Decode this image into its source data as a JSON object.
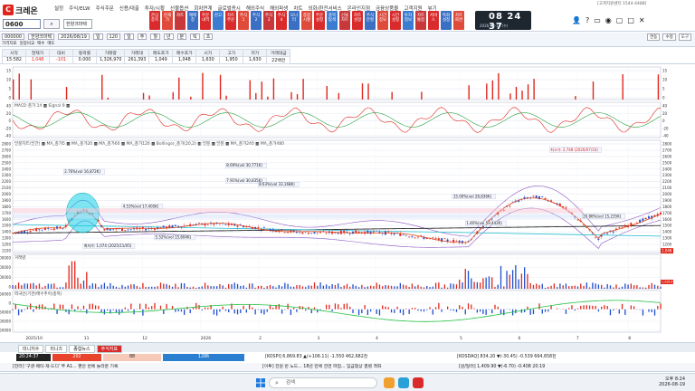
{
  "app": {
    "title": "크레온",
    "logo_letter": "C"
  },
  "menu": [
    "설정",
    "주식/ELW",
    "주식주문",
    "신용/대출",
    "투자/시황",
    "선물옵션",
    "회차연계",
    "글로벌증시",
    "해외주식",
    "해외파생",
    "차트",
    "외화/환전서비스",
    "온라인지점",
    "금융상품몰",
    "고객지원",
    "뷰기"
  ],
  "code": "0600",
  "stock_name": "한양크마텍",
  "toolbar": [
    "관심\n종목",
    "현재\n가",
    "차트",
    "매매\n창",
    "주문\n내역",
    "잔고",
    "차트\n주문",
    "주식\n1",
    "주식\n2",
    "주식\n3",
    "주식\n4",
    "모니\n터",
    "종합\n시황",
    "주문\n설정",
    "종목\n탐색",
    "선물\n차트",
    "차트\n설정",
    "주식\n분할",
    "시간\n정보",
    "시간\n설정",
    "투자\n정보",
    "차트\n통합",
    "서비\n스",
    "특화\n설정",
    "차트\n화면"
  ],
  "clock": {
    "time": "08 24 37",
    "date": "2026-08-19 (수)"
  },
  "top_right": "[고객지원센터 1544-4488]",
  "controls": {
    "code": "000000",
    "name": "한양크마텍",
    "date": "2026/08/19",
    "period": "일",
    "count": "120",
    "labels": [
      "일",
      "주",
      "월",
      "년",
      "분",
      "틱",
      "초"
    ],
    "right_buttons": [
      "연동",
      "수정",
      "도구"
    ],
    "sub_tabs": [
      "가격지표",
      "일봉비교",
      "매수",
      "매도"
    ]
  },
  "quote": {
    "headers": [
      "시작",
      "현재가",
      "대비",
      "등락률",
      "거래량",
      "거래대",
      "매도호가",
      "매수호가",
      "시가",
      "고가",
      "저가",
      "거래대금"
    ],
    "values": [
      "15:582",
      "1,048",
      "-101",
      "0.000",
      "1,326,970",
      "261,393",
      "1,049",
      "1,048",
      "1,630",
      "1,950",
      "1,630",
      "22백만"
    ]
  },
  "chart": {
    "macd_label": "MACD 종가 14 ■ Signal 9 ■",
    "price_label": "일봉차트(일간) ■ MA_종가5 ■ MA_종가20 ■ MA_종가60 ■ MA_종가120 ■ Bollinger_종가(20,2) ■ 일봉 ■ 일봉 ■ MA_종가240 ■ MA_종가480",
    "volume_label": "거래량",
    "investor_label": "외국인(기관)매수추이(종목)",
    "price_annotations": [
      "최고가: 2,748 (2026/07/10)",
      "최저가: 1,074 (2025/11/05)",
      "8.69%(vol 30,771K)",
      "7.91%(vol 30,835K)",
      "8.63%(vol 33,168K)",
      "2.76%(vol 16,872K)",
      "4.53%(vol 17,405K)",
      "5.52%(vol 15,604K)",
      "15.00%(vol 28,836K)",
      "1.46%(vol 59,442K)",
      "20.86%(vol 15,235K)"
    ],
    "x_labels": [
      "2025/10",
      "11",
      "12",
      "2026",
      "2",
      "3",
      "4",
      "5",
      "6",
      "7",
      "8"
    ],
    "price_y": [
      "2800",
      "2700",
      "2600",
      "2500",
      "2400",
      "2300",
      "2200",
      "2100",
      "2000",
      "1900",
      "1800",
      "1700",
      "1600",
      "1500",
      "1400",
      "1300",
      "1200",
      "1100"
    ],
    "vol_y": [
      "300000",
      "200000",
      "100000",
      "0"
    ],
    "inv_y": [
      "50000",
      "0",
      "-50000",
      "-100000",
      "-150000"
    ],
    "macd_y": [
      "40",
      "20",
      "0",
      "-20",
      "-40"
    ],
    "top_y": [
      "15",
      "10",
      "5",
      "0"
    ],
    "last_price": "1,048",
    "last_vol": "1,326,970"
  },
  "bottom_tabs": [
    "미니지수",
    "미니즈",
    "종합뉴스",
    "주식지표"
  ],
  "ticker1": {
    "time": "20:24:37",
    "vals": [
      "202",
      "88",
      "1286"
    ],
    "kospi": "[KOSPI] 6,869.83 ▲(+106.11) -1.550 462,682천",
    "kosdaq": "[KOSDAQ] 834.20 ▼(-30.45) -0.539 664,658천"
  },
  "ticker2": {
    "news": "[한라] '구글·메타·재·드디' 뚜 A1... 편안 번에 놀라운 기록",
    "news2": "[이투] 전원 반 노드... 18년 만에 전면 파업... 임금협상 결렬 격화",
    "fx": "[원/달러] 1,409.90 ▼(-6.70) -0.408 20:19"
  },
  "taskbar": {
    "search": "검색",
    "time": "오후 8:24",
    "date": "2026-08-19"
  }
}
